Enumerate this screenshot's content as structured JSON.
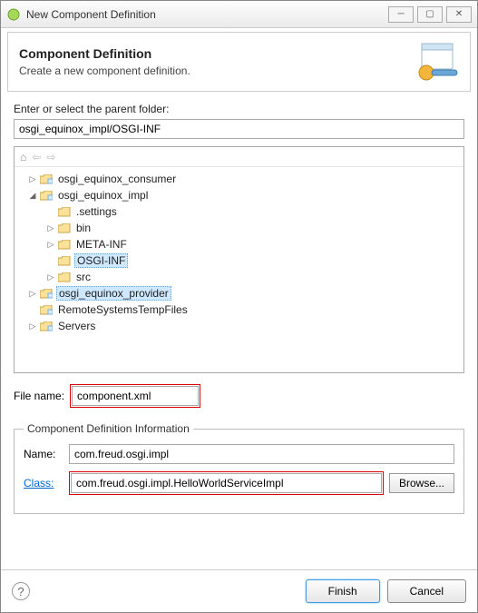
{
  "window": {
    "title": "New Component Definition"
  },
  "banner": {
    "title": "Component Definition",
    "description": "Create a new component definition."
  },
  "folder": {
    "label": "Enter or select the parent folder:",
    "path": "osgi_equinox_impl/OSGI-INF"
  },
  "tree": {
    "items": [
      {
        "label": "osgi_equinox_consumer",
        "icon": "project",
        "depth": 0,
        "expand": "right",
        "selected": false
      },
      {
        "label": "osgi_equinox_impl",
        "icon": "project",
        "depth": 0,
        "expand": "down",
        "selected": false
      },
      {
        "label": ".settings",
        "icon": "folder",
        "depth": 1,
        "expand": "",
        "selected": false
      },
      {
        "label": "bin",
        "icon": "folder",
        "depth": 1,
        "expand": "right",
        "selected": false
      },
      {
        "label": "META-INF",
        "icon": "folder",
        "depth": 1,
        "expand": "right",
        "selected": false
      },
      {
        "label": "OSGI-INF",
        "icon": "folder",
        "depth": 1,
        "expand": "",
        "selected": true
      },
      {
        "label": "src",
        "icon": "folder",
        "depth": 1,
        "expand": "right",
        "selected": false
      },
      {
        "label": "osgi_equinox_provider",
        "icon": "project",
        "depth": 0,
        "expand": "right",
        "selected": true
      },
      {
        "label": "RemoteSystemsTempFiles",
        "icon": "project",
        "depth": 0,
        "expand": "",
        "selected": false
      },
      {
        "label": "Servers",
        "icon": "project",
        "depth": 0,
        "expand": "right",
        "selected": false
      }
    ]
  },
  "filename": {
    "label": "File name:",
    "value": "component.xml"
  },
  "group": {
    "legend": "Component Definition Information",
    "name_label": "Name:",
    "name_value": "com.freud.osgi.impl",
    "class_label": "Class:",
    "class_value": "com.freud.osgi.impl.HelloWorldServiceImpl",
    "browse_label": "Browse..."
  },
  "footer": {
    "finish": "Finish",
    "cancel": "Cancel"
  }
}
